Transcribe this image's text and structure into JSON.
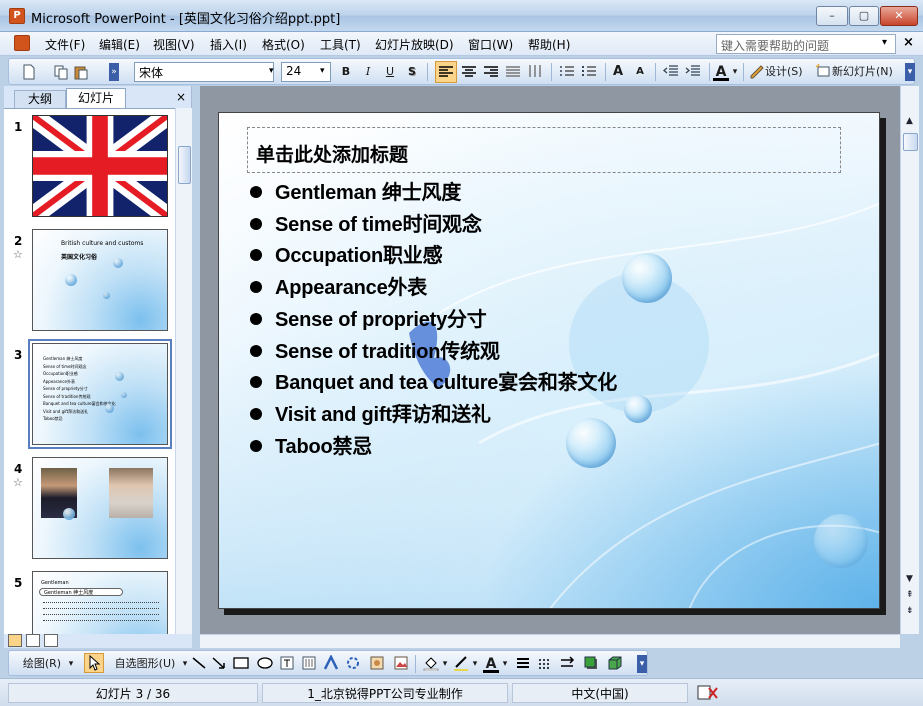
{
  "window": {
    "title": "Microsoft PowerPoint - [英国文化习俗介绍ppt.ppt]",
    "app_icon_letter": "P",
    "min_label": "–",
    "max_label": "▢",
    "close_label": "✕"
  },
  "menu": {
    "items": [
      "文件(F)",
      "编辑(E)",
      "视图(V)",
      "插入(I)",
      "格式(O)",
      "工具(T)",
      "幻灯片放映(D)",
      "窗口(W)",
      "帮助(H)"
    ],
    "help_placeholder": "键入需要帮助的问题",
    "help_arrow": "▾",
    "close": "×"
  },
  "toolbar": {
    "font_name": "宋体",
    "font_size": "24",
    "bold": "B",
    "italic": "I",
    "underline": "U",
    "shadow": "S",
    "grow_font": "A",
    "shrink_font": "A",
    "font_color": "A",
    "design_label": "设计(S)",
    "new_slide_label": "新幻灯片(N)",
    "dropdown_arrow": "▾"
  },
  "left_pane": {
    "tab_outline": "大纲",
    "tab_slides": "幻灯片",
    "close": "×",
    "slide_numbers": [
      "1",
      "2",
      "3",
      "4",
      "5"
    ],
    "star": "☆",
    "thumb2_title": "British culture and customs",
    "thumb2_subtitle": "英国文化习俗",
    "thumb3_lines": [
      "Gentleman 绅士风度",
      "Sense of time时间观念",
      "Occupation职业感",
      "Appearance外表",
      "Sense of propriety分寸",
      "Sense of tradition传统观",
      "Banquet and tea culture宴会和茶文化",
      "Visit and gift拜访和送礼",
      "Taboo禁忌"
    ],
    "thumb5_heading": "Gentleman",
    "thumb5_bar": "Gentleman 绅士风度"
  },
  "slide": {
    "title_placeholder": "单击此处添加标题",
    "bullets": [
      "Gentleman 绅士风度",
      "Sense of time时间观念",
      "Occupation职业感",
      "Appearance外表",
      "Sense of propriety分寸",
      "Sense of tradition传统观",
      "Banquet and tea culture宴会和茶文化",
      "Visit and gift拜访和送礼",
      "Taboo禁忌"
    ]
  },
  "drawing_toolbar": {
    "draw_label": "绘图(R)",
    "autoshapes_label": "自选图形(U)",
    "arrow": "▾"
  },
  "status": {
    "slide_position": "幻灯片 3 / 36",
    "design_template": "1_北京锐得PPT公司专业制作",
    "language": "中文(中国)"
  },
  "colors": {
    "accent": "#fbd48a",
    "flag_red": "#e51c24",
    "flag_blue": "#12236b",
    "slide_blue": "#5fb3ea"
  }
}
